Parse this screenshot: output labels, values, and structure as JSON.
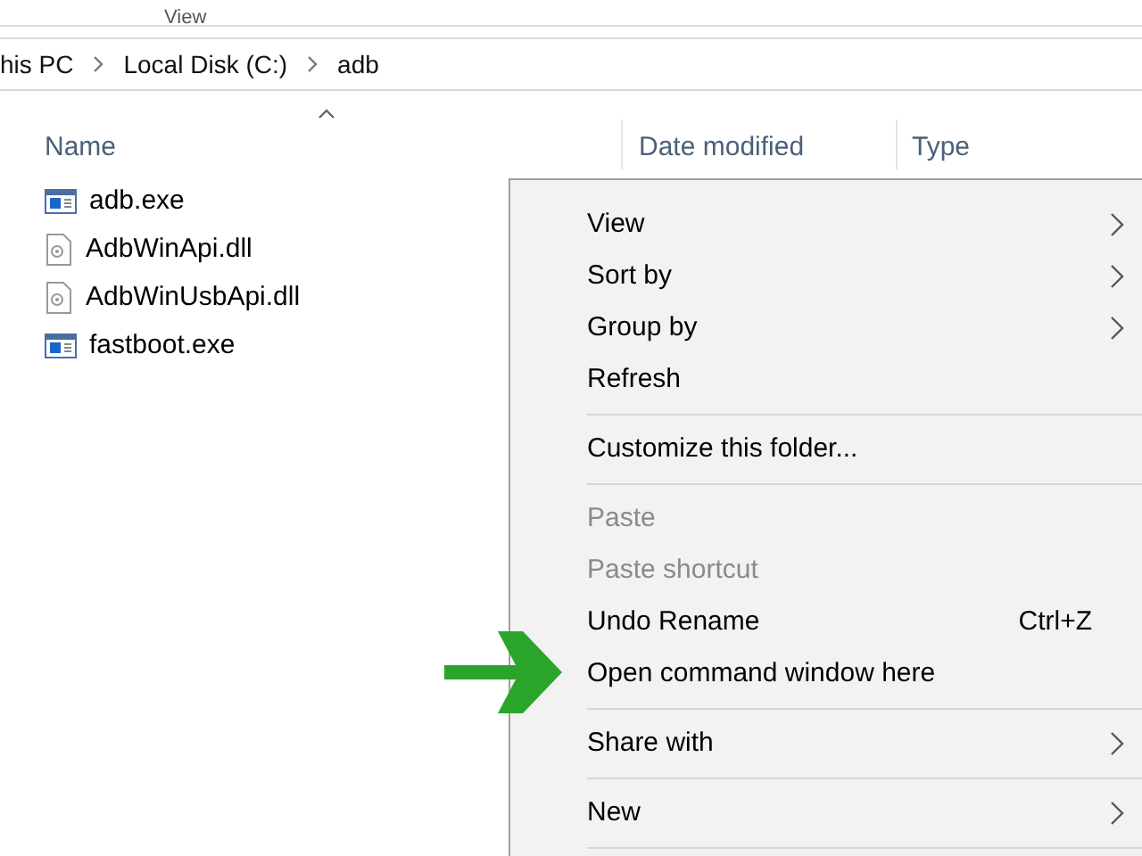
{
  "ribbon": {
    "tab": "View"
  },
  "breadcrumb": [
    "his PC",
    "Local Disk (C:)",
    "adb"
  ],
  "columns": [
    {
      "label": "Name",
      "sorted": true
    },
    {
      "label": "Date modified",
      "sorted": false
    },
    {
      "label": "Type",
      "sorted": false
    }
  ],
  "files": [
    {
      "name": "adb.exe",
      "kind": "exe"
    },
    {
      "name": "AdbWinApi.dll",
      "kind": "dll"
    },
    {
      "name": "AdbWinUsbApi.dll",
      "kind": "dll"
    },
    {
      "name": "fastboot.exe",
      "kind": "exe"
    }
  ],
  "context_menu": [
    {
      "kind": "item",
      "label": "View",
      "disabled": false,
      "submenu": true
    },
    {
      "kind": "item",
      "label": "Sort by",
      "disabled": false,
      "submenu": true
    },
    {
      "kind": "item",
      "label": "Group by",
      "disabled": false,
      "submenu": true
    },
    {
      "kind": "item",
      "label": "Refresh",
      "disabled": false,
      "submenu": false
    },
    {
      "kind": "separator"
    },
    {
      "kind": "item",
      "label": "Customize this folder...",
      "disabled": false,
      "submenu": false
    },
    {
      "kind": "separator"
    },
    {
      "kind": "item",
      "label": "Paste",
      "disabled": true,
      "submenu": false
    },
    {
      "kind": "item",
      "label": "Paste shortcut",
      "disabled": true,
      "submenu": false
    },
    {
      "kind": "item",
      "label": "Undo Rename",
      "disabled": false,
      "submenu": false,
      "shortcut": "Ctrl+Z"
    },
    {
      "kind": "item",
      "label": "Open command window here",
      "disabled": false,
      "submenu": false,
      "highlighted": true
    },
    {
      "kind": "separator"
    },
    {
      "kind": "item",
      "label": "Share with",
      "disabled": false,
      "submenu": true
    },
    {
      "kind": "separator"
    },
    {
      "kind": "item",
      "label": "New",
      "disabled": false,
      "submenu": true
    },
    {
      "kind": "separator"
    }
  ]
}
